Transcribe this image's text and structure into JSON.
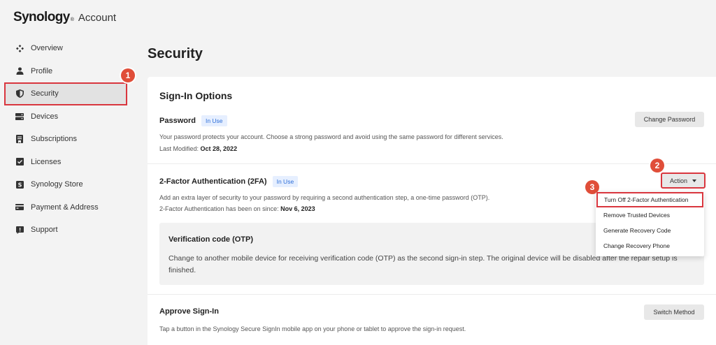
{
  "app": {
    "brand": "Synology",
    "reg": "®",
    "product": "Account"
  },
  "sidebar": {
    "items": [
      {
        "label": "Overview",
        "icon": "overview-icon"
      },
      {
        "label": "Profile",
        "icon": "person-icon"
      },
      {
        "label": "Security",
        "icon": "shield-icon",
        "active": true
      },
      {
        "label": "Devices",
        "icon": "devices-icon"
      },
      {
        "label": "Subscriptions",
        "icon": "subscriptions-icon"
      },
      {
        "label": "Licenses",
        "icon": "license-icon"
      },
      {
        "label": "Synology Store",
        "icon": "store-icon"
      },
      {
        "label": "Payment & Address",
        "icon": "card-icon"
      },
      {
        "label": "Support",
        "icon": "support-icon"
      }
    ]
  },
  "markers": [
    "1",
    "2",
    "3"
  ],
  "main": {
    "title": "Security",
    "card_title": "Sign-In Options",
    "password": {
      "title": "Password",
      "tag": "In Use",
      "desc": "Your password protects your account. Choose a strong password and avoid using the same password for different services.",
      "modified_label": "Last Modified: ",
      "modified_value": "Oct 28, 2022",
      "button": "Change Password"
    },
    "twofa": {
      "title": "2-Factor Authentication (2FA)",
      "tag": "In Use",
      "desc": "Add an extra layer of security to your password by requiring a second authentication step, a one-time password (OTP).",
      "since_label": "2-Factor Authentication has been on since: ",
      "since_value": "Nov 6, 2023",
      "button": "Action"
    },
    "otp": {
      "title": "Verification code (OTP)",
      "desc": "Change to another mobile device for receiving verification code (OTP) as the second sign-in step. The original device will be disabled after the repair setup is finished."
    },
    "approve": {
      "title": "Approve Sign-In",
      "desc": "Tap a button in the Synology Secure SignIn mobile app on your phone or tablet to approve the sign-in request.",
      "button": "Switch Method"
    }
  },
  "action_menu": {
    "items": [
      "Turn Off 2-Factor Authentication",
      "Remove Trusted Devices",
      "Generate Recovery Code",
      "Change Recovery Phone"
    ]
  },
  "colors": {
    "highlight": "#d9363e",
    "marker": "#e04e39",
    "tag_bg": "#e6efff",
    "tag_text": "#2e6fd8"
  }
}
